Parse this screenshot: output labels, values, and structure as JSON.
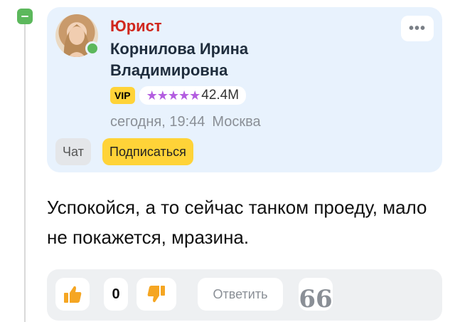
{
  "comment": {
    "author": {
      "role": "Юрист",
      "name": "Корнилова Ирина Владимировна",
      "badge": "VIP",
      "stars": "★★★★★",
      "rating_value": "42.4M",
      "online": true
    },
    "date": "сегодня, 19:44",
    "location": "Москва",
    "buttons": {
      "chat": "Чат",
      "subscribe": "Подписаться",
      "more": "•••"
    },
    "text": "Успокойся, а то сейчас танком проеду, мало не покажется, мразина.",
    "actions": {
      "like_count": "0",
      "reply": "Ответить",
      "quote": "66"
    }
  },
  "colors": {
    "accent_green": "#5cb85c",
    "role_red": "#d0271d",
    "vip_yellow": "#ffd338",
    "stars_purple": "#b35de0",
    "card_bg": "#e8f2fd",
    "thumb_orange": "#f5a623"
  },
  "icons": [
    "collapse-icon",
    "thumbs-up-icon",
    "thumbs-down-icon",
    "quote-icon",
    "more-icon"
  ]
}
